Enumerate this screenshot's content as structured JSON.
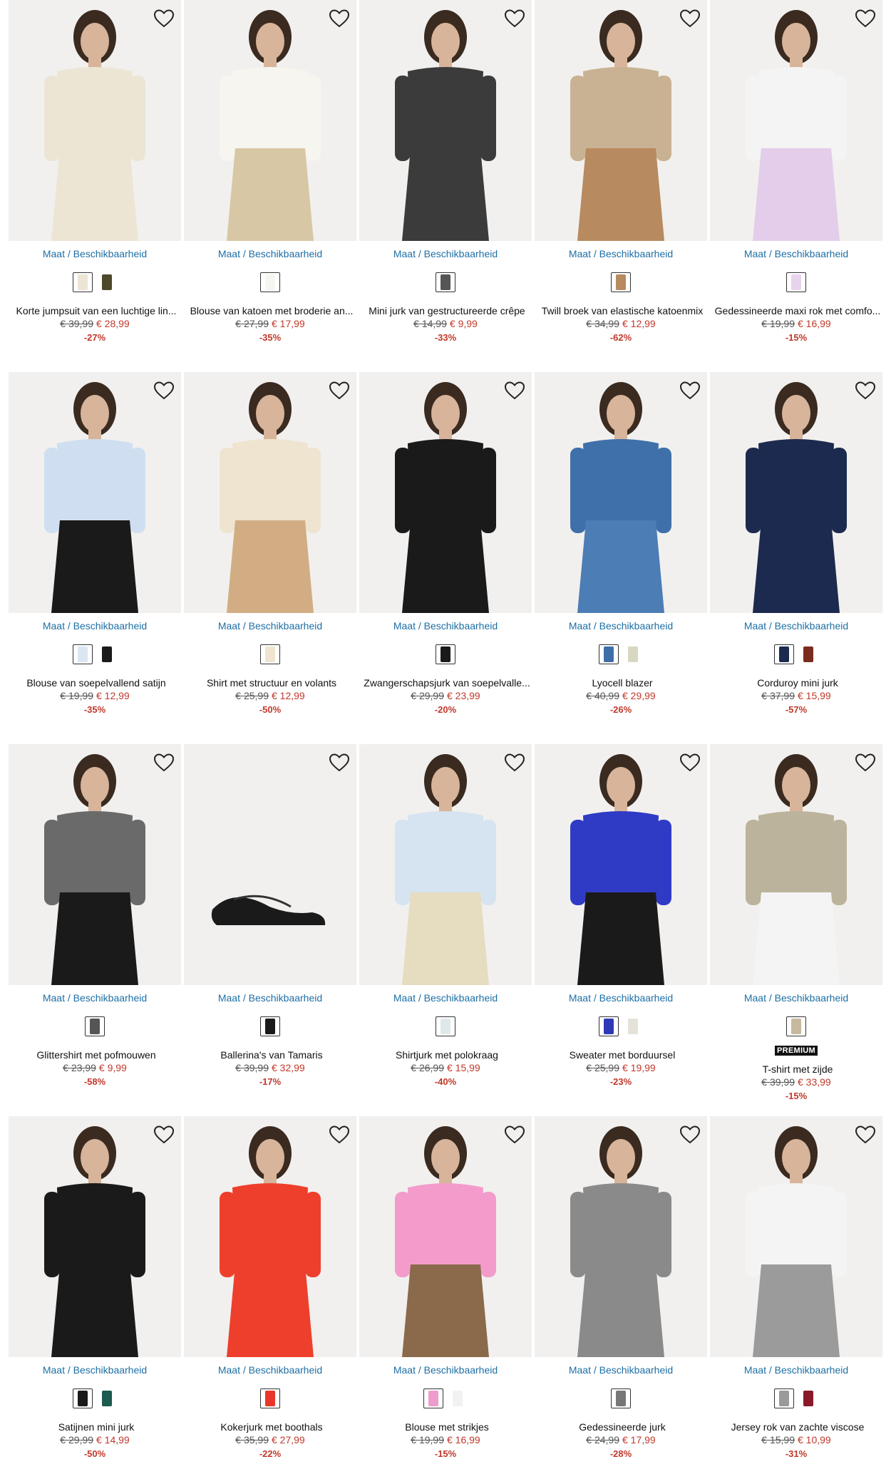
{
  "size_label": "Maat / Beschikbaarheid",
  "colors": {
    "link": "#1d6fa5",
    "sale": "#c0392b",
    "image_bg": "#f1f0ee"
  },
  "icons": {
    "wishlist": "heart-outline-icon"
  },
  "products": [
    {
      "name": "Korte jumpsuit van een luchtige lin...",
      "old_price": "€ 39,99",
      "new_price": "€ 28,99",
      "discount": "-27%",
      "swatches": [
        "#ece5d4",
        "#4c4a2a"
      ],
      "garment": "#ece5d4",
      "lower": "#ece5d4"
    },
    {
      "name": "Blouse van katoen met broderie an...",
      "old_price": "€ 27,99",
      "new_price": "€ 17,99",
      "discount": "-35%",
      "swatches": [
        "#f7f5f0"
      ],
      "garment": "#f7f5f0",
      "lower": "#d8c7a4"
    },
    {
      "name": "Mini jurk van gestructureerde crêpe",
      "old_price": "€ 14,99",
      "new_price": "€ 9,99",
      "discount": "-33%",
      "swatches": [
        "#555555"
      ],
      "garment": "#3b3b3b",
      "lower": "#3b3b3b"
    },
    {
      "name": "Twill broek van elastische katoenmix",
      "old_price": "€ 34,99",
      "new_price": "€ 12,99",
      "discount": "-62%",
      "swatches": [
        "#b88a5f"
      ],
      "garment": "#c9b293",
      "lower": "#b88a5f"
    },
    {
      "name": "Gedessineerde maxi rok met comfo...",
      "old_price": "€ 19,99",
      "new_price": "€ 16,99",
      "discount": "-15%",
      "swatches": [
        "#e8d3ec"
      ],
      "garment": "#f4f4f4",
      "lower": "#e3cdea"
    },
    {
      "name": "Blouse van soepelvallend satijn",
      "old_price": "€ 19,99",
      "new_price": "€ 12,99",
      "discount": "-35%",
      "swatches": [
        "#dbe6f3",
        "#1a1a1a"
      ],
      "garment": "#cfdff1",
      "lower": "#1a1a1a"
    },
    {
      "name": "Shirt met structuur en volants",
      "old_price": "€ 25,99",
      "new_price": "€ 12,99",
      "discount": "-50%",
      "swatches": [
        "#efe4cf"
      ],
      "garment": "#efe4cf",
      "lower": "#d2ad84"
    },
    {
      "name": "Zwangerschapsjurk van soepelvalle...",
      "old_price": "€ 29,99",
      "new_price": "€ 23,99",
      "discount": "-20%",
      "swatches": [
        "#1a1a1a"
      ],
      "garment": "#1a1a1a",
      "lower": "#1a1a1a"
    },
    {
      "name": "Lyocell blazer",
      "old_price": "€ 40,99",
      "new_price": "€ 29,99",
      "discount": "-26%",
      "swatches": [
        "#3e6ea8",
        "#d8d8c2"
      ],
      "garment": "#3f70aa",
      "lower": "#4c7db4"
    },
    {
      "name": "Corduroy mini jurk",
      "old_price": "€ 37,99",
      "new_price": "€ 15,99",
      "discount": "-57%",
      "swatches": [
        "#1d2a4f",
        "#7a2c1f"
      ],
      "garment": "#1d2a4f",
      "lower": "#1d2a4f"
    },
    {
      "name": "Glittershirt met pofmouwen",
      "old_price": "€ 23,99",
      "new_price": "€ 9,99",
      "discount": "-58%",
      "swatches": [
        "#555555"
      ],
      "garment": "#6a6a6a",
      "lower": "#1a1a1a"
    },
    {
      "name": "Ballerina's van Tamaris",
      "old_price": "€ 39,99",
      "new_price": "€ 32,99",
      "discount": "-17%",
      "swatches": [
        "#1a1a1a"
      ],
      "garment": "shoe",
      "lower": "#1a1a1a"
    },
    {
      "name": "Shirtjurk met polokraag",
      "old_price": "€ 26,99",
      "new_price": "€ 15,99",
      "discount": "-40%",
      "swatches": [
        "#dfe8ea"
      ],
      "garment": "#d6e3f0",
      "lower": "#e6dcc0"
    },
    {
      "name": "Sweater met borduursel",
      "old_price": "€ 25,99",
      "new_price": "€ 19,99",
      "discount": "-23%",
      "swatches": [
        "#2f39b5",
        "#e5e3d8"
      ],
      "garment": "#2f3bc4",
      "lower": "#1a1a1a"
    },
    {
      "name": "T-shirt met zijde",
      "old_price": "€ 39,99",
      "new_price": "€ 33,99",
      "discount": "-15%",
      "swatches": [
        "#c7b9a0"
      ],
      "badge": "PREMIUM",
      "garment": "#bcb39c",
      "lower": "#f4f4f4"
    },
    {
      "name": "Satijnen mini jurk",
      "old_price": "€ 29,99",
      "new_price": "€ 14,99",
      "discount": "-50%",
      "swatches": [
        "#1a1a1a",
        "#1d5a4f"
      ],
      "garment": "#1a1a1a",
      "lower": "#1a1a1a"
    },
    {
      "name": "Kokerjurk met boothals",
      "old_price": "€ 35,99",
      "new_price": "€ 27,99",
      "discount": "-22%",
      "swatches": [
        "#e8372a"
      ],
      "garment": "#ee3f2c",
      "lower": "#ee3f2c"
    },
    {
      "name": "Blouse met strikjes",
      "old_price": "€ 19,99",
      "new_price": "€ 16,99",
      "discount": "-15%",
      "swatches": [
        "#ee9ccb",
        "#f2f2f2"
      ],
      "garment": "#f39ccc",
      "lower": "#8a6a4a"
    },
    {
      "name": "Gedessineerde jurk",
      "old_price": "€ 24,99",
      "new_price": "€ 17,99",
      "discount": "-28%",
      "swatches": [
        "#777777"
      ],
      "garment": "#8a8a8a",
      "lower": "#8a8a8a"
    },
    {
      "name": "Jersey rok van zachte viscose",
      "old_price": "€ 15,99",
      "new_price": "€ 10,99",
      "discount": "-31%",
      "swatches": [
        "#9a9a9a",
        "#8a1a2a"
      ],
      "garment": "#f4f4f4",
      "lower": "#9b9b9b"
    }
  ]
}
